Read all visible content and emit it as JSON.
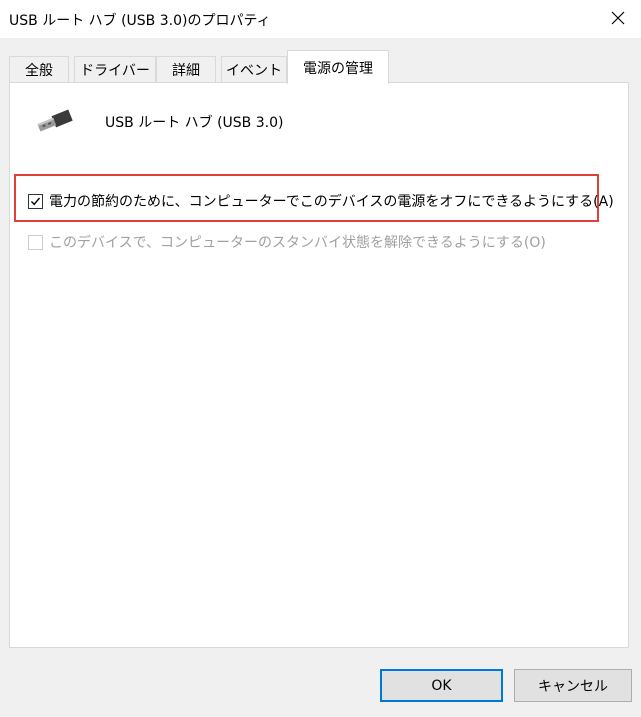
{
  "window": {
    "title": "USB ルート ハブ (USB 3.0)のプロパティ"
  },
  "tabs": [
    {
      "label": "全般"
    },
    {
      "label": "ドライバー"
    },
    {
      "label": "詳細"
    },
    {
      "label": "イベント"
    },
    {
      "label": "電源の管理"
    }
  ],
  "device": {
    "name": "USB ルート ハブ (USB 3.0)",
    "icon": "usb-plug-icon"
  },
  "options": {
    "allow_turn_off": {
      "label": "電力の節約のために、コンピューターでこのデバイスの電源をオフにできるようにする(A)",
      "checked": true
    },
    "allow_wake": {
      "label": "このデバイスで、コンピューターのスタンバイ状態を解除できるようにする(O)",
      "checked": false
    }
  },
  "buttons": {
    "ok": "OK",
    "cancel": "キャンセル"
  },
  "colors": {
    "highlight": "#e0403a",
    "accent": "#0078d7"
  }
}
